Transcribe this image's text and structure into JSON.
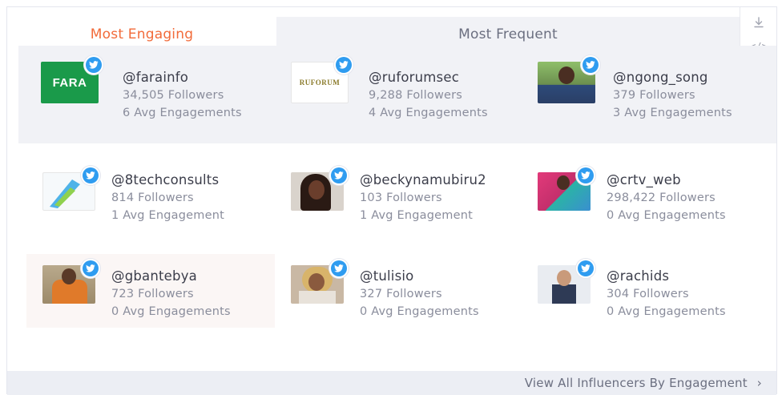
{
  "tabs": [
    {
      "label": "Most Engaging",
      "active": true
    },
    {
      "label": "Most Frequent",
      "active": false
    }
  ],
  "icons": {
    "download": "download-icon",
    "embed": "code-icon",
    "badge": "twitter-icon"
  },
  "colors": {
    "active_tab": "#f26b3a",
    "twitter_blue": "#2f9cf0",
    "row_highlight": "#f1f2f6"
  },
  "influencers": [
    {
      "handle": "@farainfo",
      "followers": "34,505 Followers",
      "engagement": "6 Avg Engagements",
      "logo_text": "FARA"
    },
    {
      "handle": "@ruforumsec",
      "followers": "9,288 Followers",
      "engagement": "4 Avg Engagements",
      "logo_text": "RUFORUM"
    },
    {
      "handle": "@ngong_song",
      "followers": "379 Followers",
      "engagement": "3 Avg Engagements"
    },
    {
      "handle": "@8techconsults",
      "followers": "814 Followers",
      "engagement": "1 Avg Engagement"
    },
    {
      "handle": "@beckynamubiru2",
      "followers": "103 Followers",
      "engagement": "1 Avg Engagement"
    },
    {
      "handle": "@crtv_web",
      "followers": "298,422 Followers",
      "engagement": "0 Avg Engagements"
    },
    {
      "handle": "@gbantebya",
      "followers": "723 Followers",
      "engagement": "0 Avg Engagements"
    },
    {
      "handle": "@tulisio",
      "followers": "327 Followers",
      "engagement": "0 Avg Engagements"
    },
    {
      "handle": "@rachids",
      "followers": "304 Followers",
      "engagement": "0 Avg Engagements"
    }
  ],
  "footer": {
    "link_label": "View All Influencers By Engagement",
    "chevron": "›"
  }
}
